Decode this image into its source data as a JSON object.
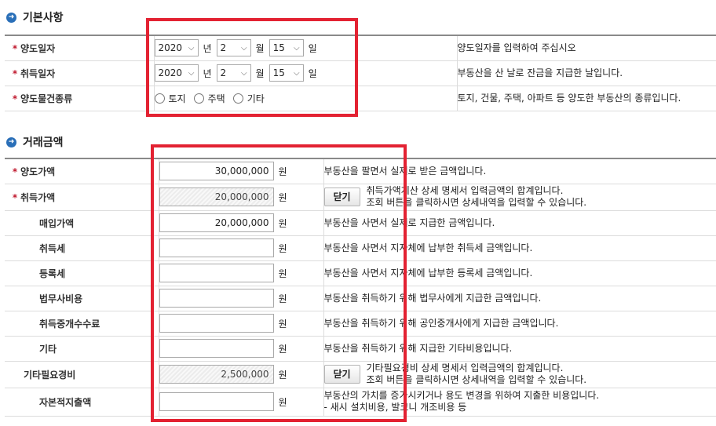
{
  "basic": {
    "title": "기본사항",
    "transfer_date": {
      "label": "양도일자",
      "year": "2020",
      "year_unit": "년",
      "month": "2",
      "month_unit": "월",
      "day": "15",
      "day_unit": "일",
      "desc": "양도일자를 입력하여 주십시오"
    },
    "acquire_date": {
      "label": "취득일자",
      "year": "2020",
      "year_unit": "년",
      "month": "2",
      "month_unit": "월",
      "day": "15",
      "day_unit": "일",
      "desc": "부동산을 산 날로 잔금을 지급한 날입니다."
    },
    "property_type": {
      "label": "양도물건종류",
      "options": [
        "토지",
        "주택",
        "기타"
      ],
      "desc": "토지, 건물, 주택, 아파트 등 양도한 부동산의 종류입니다."
    }
  },
  "transaction": {
    "title": "거래금액",
    "currency_unit": "원",
    "close_label": "닫기",
    "rows": [
      {
        "label": "양도가액",
        "value": "30,000,000",
        "desc": "부동산을 팔면서 실제로 받은 금액입니다."
      },
      {
        "label": "취득가액",
        "value": "20,000,000",
        "desc1": "취득가액계산 상세 명세서 입력금액의 합계입니다.",
        "desc2": "조회 버튼을 클릭하시면 상세내역을 입력할 수 있습니다."
      },
      {
        "label": "매입가액",
        "value": "20,000,000",
        "desc": "부동산을 사면서 실제로 지급한 금액입니다."
      },
      {
        "label": "취득세",
        "value": "",
        "desc": "부동산을 사면서 지자체에 납부한 취득세 금액입니다."
      },
      {
        "label": "등록세",
        "value": "",
        "desc": "부동산을 사면서 지자체에 납부한 등록세 금액입니다."
      },
      {
        "label": "법무사비용",
        "value": "",
        "desc": "부동산을 취득하기 위해 법무사에게 지급한 금액입니다."
      },
      {
        "label": "취득중개수수료",
        "value": "",
        "desc": "부동산을 취득하기 위해 공인중개사에게 지급한 금액입니다."
      },
      {
        "label": "기타",
        "value": "",
        "desc": "부동산을 취득하기 위해 지급한 기타비용입니다."
      },
      {
        "label": "기타필요경비",
        "value": "2,500,000",
        "desc1": "기타필요경비 상세 명세서 입력금액의 합계입니다.",
        "desc2": "조회 버튼을 클릭하시면 상세내역을 입력할 수 있습니다."
      },
      {
        "label": "자본적지출액",
        "value": "",
        "desc1": "부동산의 가치를 증가시키거나 용도 변경을 위하여 지출한 비용입니다.",
        "desc2": "- 새시 설치비용, 발코니 개조비용 등"
      }
    ]
  }
}
